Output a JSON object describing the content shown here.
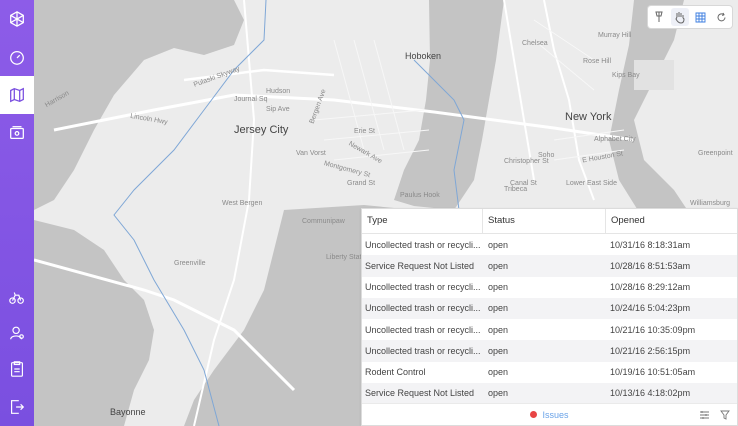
{
  "map": {
    "city_labels": [
      "Jersey City",
      "Hoboken",
      "New York",
      "Bayonne"
    ],
    "street_labels": [
      "Pulaski Skyway",
      "Lincoln Hwy",
      "Newark Ave",
      "Grand St",
      "Communipaw",
      "West Bergen",
      "Greenville",
      "Liberty State",
      "Montgomery St",
      "Erie St",
      "Christopher St",
      "Canal St",
      "E Houston St",
      "Chelsea",
      "Murray Hill",
      "Kips Bay",
      "Rose Hill",
      "Alphabet City",
      "Lower East Side",
      "Greenpoint",
      "Williamsburg",
      "Soho",
      "Tribeca",
      "Journal Sq",
      "Sip Ave",
      "Hudson",
      "Van Vorst",
      "Bergen Ave",
      "Harrison",
      "Paulus Hook"
    ]
  },
  "toolbar": {
    "icons": [
      "pin-icon",
      "hand-icon",
      "grid-icon",
      "refresh-icon"
    ]
  },
  "sidebar": {
    "items": [
      "logo-icon",
      "dashboard-icon",
      "map-icon",
      "cards-icon",
      "bike-settings-icon",
      "user-settings-icon",
      "clipboard-icon",
      "exit-icon"
    ],
    "active": "map-icon"
  },
  "issues_panel": {
    "columns": [
      "Type",
      "Status",
      "Opened"
    ],
    "rows": [
      {
        "type": "Uncollected trash or recycli...",
        "status": "open",
        "opened": "10/31/16 8:18:31am"
      },
      {
        "type": "Service Request Not Listed",
        "status": "open",
        "opened": "10/28/16 8:51:53am"
      },
      {
        "type": "Uncollected trash or recycli...",
        "status": "open",
        "opened": "10/28/16 8:29:12am"
      },
      {
        "type": "Uncollected trash or recycli...",
        "status": "open",
        "opened": "10/24/16 5:04:23pm"
      },
      {
        "type": "Uncollected trash or recycli...",
        "status": "open",
        "opened": "10/21/16 10:35:09pm"
      },
      {
        "type": "Uncollected trash or recycli...",
        "status": "open",
        "opened": "10/21/16 2:56:15pm"
      },
      {
        "type": "Rodent Control",
        "status": "open",
        "opened": "10/19/16 10:51:05am"
      },
      {
        "type": "Service Request Not Listed",
        "status": "open",
        "opened": "10/13/16 4:18:02pm"
      }
    ],
    "footer_label": "Issues",
    "footer_dot_color": "#e84545",
    "accent_color": "#6aa3e8"
  },
  "colors": {
    "sidebar": "#8a5ae6",
    "water": "#c4c4c4",
    "land": "#ececec"
  }
}
